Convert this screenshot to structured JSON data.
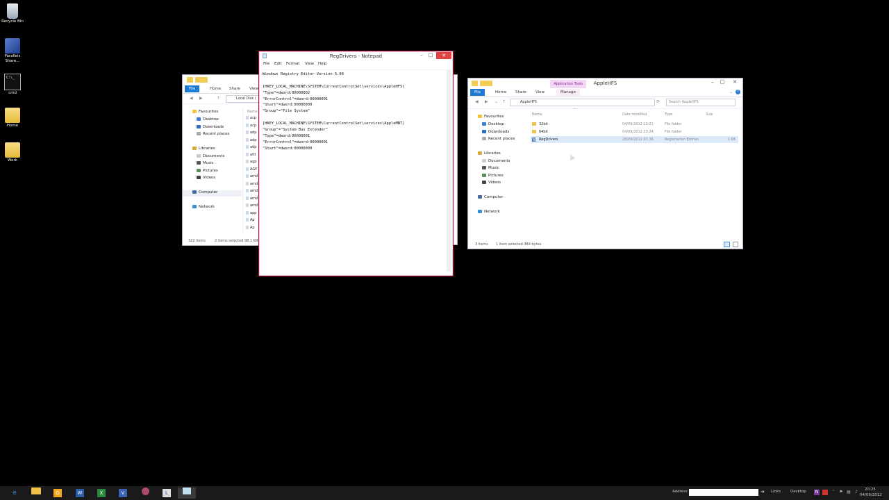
{
  "desktop": {
    "icons": [
      {
        "label": "Recycle Bin"
      },
      {
        "label": "Parallels Share..."
      },
      {
        "label": "cmd"
      },
      {
        "label": "Home"
      },
      {
        "label": "Work"
      }
    ]
  },
  "left_explorer": {
    "tabs": [
      "File",
      "Home",
      "Share",
      "View"
    ],
    "address": "Local Disk (",
    "column_header": "Name",
    "nav": {
      "favourites": "Favourites",
      "desktop": "Desktop",
      "downloads": "Downloads",
      "recent": "Recent places",
      "libraries": "Libraries",
      "documents": "Documents",
      "music": "Music",
      "pictures": "Pictures",
      "videos": "Videos",
      "computer": "Computer",
      "network": "Network"
    },
    "list_stubs": [
      "acp",
      "acp",
      "adp",
      "adp",
      "adp",
      "afd",
      "agp",
      "AGP",
      "amd",
      "amd",
      "amd",
      "amd",
      "amd",
      "app",
      "Ap",
      "Ap"
    ],
    "status": {
      "count": "322 items",
      "selected": "2 items selected 98.1 KB"
    }
  },
  "notepad": {
    "title": "RegDrivers - Notepad",
    "menu": [
      "File",
      "Edit",
      "Format",
      "View",
      "Help"
    ],
    "lines": [
      "Windows Registry Editor Version 5.00",
      "",
      "[HKEY_LOCAL_MACHINE\\SYSTEM\\CurrentControlSet\\services\\AppleHFS]",
      "\"Type\"=dword:00000002",
      "\"ErrorControl\"=dword:00000001",
      "\"Start\"=dword:00000000",
      "\"Group\"=\"File System\"",
      "",
      "[HKEY_LOCAL_MACHINE\\SYSTEM\\CurrentControlSet\\services\\AppleMNT]",
      "\"Group\"=\"System Bus Extender\"",
      "\"Type\"=dword:00000001",
      "\"ErrorControl\"=dword:00000001",
      "\"Start\"=dword:00000000"
    ]
  },
  "right_explorer": {
    "title": "AppleHFS",
    "context_tab": "Application Tools",
    "tabs": [
      "File",
      "Home",
      "Share",
      "View",
      "Manage"
    ],
    "address": "AppleHFS",
    "search_placeholder": "Search AppleHFS",
    "columns": [
      "Name",
      "Date modified",
      "Type",
      "Size"
    ],
    "nav": {
      "favourites": "Favourites",
      "desktop": "Desktop",
      "downloads": "Downloads",
      "recent": "Recent places",
      "libraries": "Libraries",
      "documents": "Documents",
      "music": "Music",
      "pictures": "Pictures",
      "videos": "Videos",
      "computer": "Computer",
      "network": "Network"
    },
    "files": [
      {
        "name": "32bit",
        "date": "04/09/2012 20:21",
        "type": "File folder",
        "size": ""
      },
      {
        "name": "64bit",
        "date": "04/09/2012 20:24",
        "type": "File folder",
        "size": ""
      },
      {
        "name": "RegDrivers",
        "date": "28/09/2011 07:36",
        "type": "Registration Entries",
        "size": "1 KB"
      }
    ],
    "status": {
      "count": "3 items",
      "selected": "1 item selected 384 bytes"
    }
  },
  "taskbar": {
    "address_label": "Address",
    "links": "Links",
    "desktop": "Desktop",
    "time": "20:25",
    "date": "04/09/2012"
  },
  "colors": {
    "accent": "#1e7ad3",
    "close": "#e04343",
    "selection": "#dbe9fa"
  }
}
